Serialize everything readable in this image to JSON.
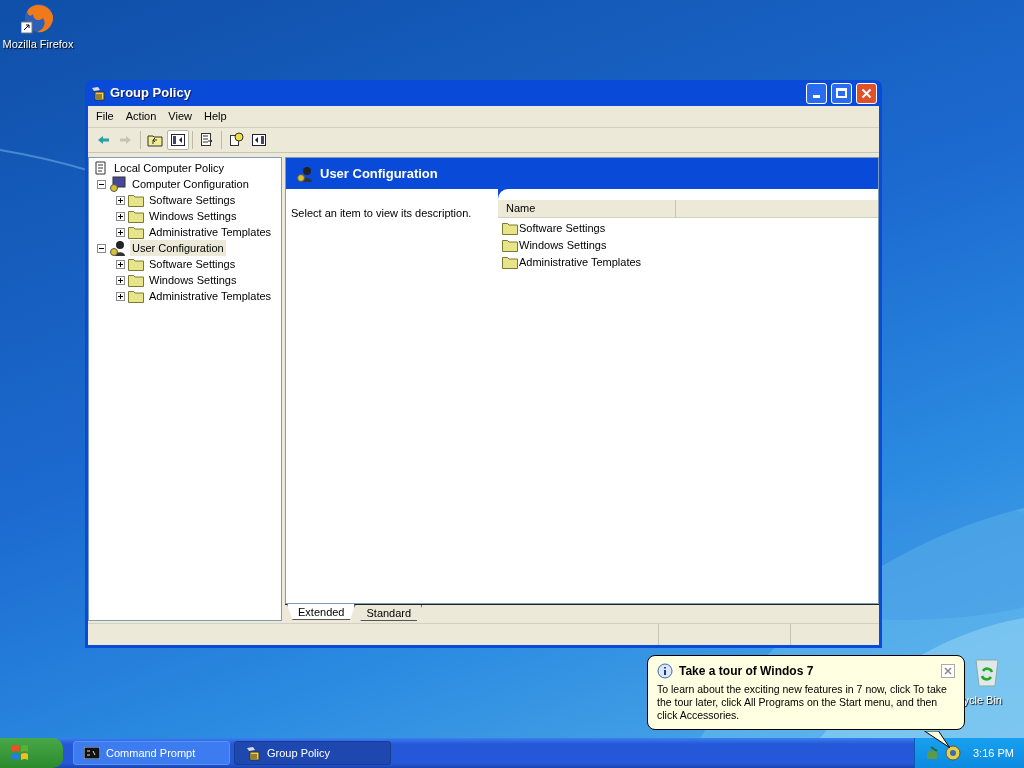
{
  "desktop_icons": [
    {
      "kind": "browser",
      "label": "Mozilla Firefox"
    },
    {
      "kind": "bin",
      "label": "ycle Bin"
    }
  ],
  "window": {
    "title": "Group Policy",
    "menu": [
      "File",
      "Action",
      "View",
      "Help"
    ],
    "toolbar": [
      {
        "kind": "back",
        "disabled": false,
        "pressed": false
      },
      {
        "kind": "forward",
        "disabled": true,
        "pressed": false
      },
      {
        "kind": "up",
        "disabled": false,
        "pressed": false
      },
      {
        "kind": "tree",
        "disabled": false,
        "pressed": true
      },
      {
        "kind": "export",
        "disabled": false,
        "pressed": false
      },
      {
        "kind": "help",
        "disabled": false,
        "pressed": false
      },
      {
        "kind": "pane",
        "disabled": false,
        "pressed": false
      }
    ],
    "tree": [
      {
        "label": "Local Computer Policy",
        "kind": "policy",
        "expanded": true,
        "selected": false,
        "children": [
          {
            "label": "Computer Configuration",
            "kind": "computer",
            "expanded": true,
            "selected": false,
            "children": [
              {
                "label": "Software Settings",
                "kind": "folder",
                "expanded": false,
                "selected": false
              },
              {
                "label": "Windows Settings",
                "kind": "folder",
                "expanded": false,
                "selected": false
              },
              {
                "label": "Administrative Templates",
                "kind": "folder",
                "expanded": false,
                "selected": false
              }
            ]
          },
          {
            "label": "User Configuration",
            "kind": "user",
            "expanded": true,
            "selected": true,
            "children": [
              {
                "label": "Software Settings",
                "kind": "folder",
                "expanded": false,
                "selected": false
              },
              {
                "label": "Windows Settings",
                "kind": "folder",
                "expanded": false,
                "selected": false
              },
              {
                "label": "Administrative Templates",
                "kind": "folder",
                "expanded": false,
                "selected": false
              }
            ]
          }
        ]
      }
    ],
    "details_title": "User Configuration",
    "description": "Select an item to view its description.",
    "list": {
      "columns": [
        "Name"
      ],
      "rows": [
        "Software Settings",
        "Windows Settings",
        "Administrative Templates"
      ]
    },
    "view_tabs": [
      {
        "label": "Extended",
        "selected": true
      },
      {
        "label": "Standard",
        "selected": false
      }
    ]
  },
  "balloon": {
    "title": "Take a tour of Windos 7",
    "text": "To learn about the exciting new features in 7 now, click To take the tour later, click All Programs on the Start menu, and then click Accessories."
  },
  "taskbar": {
    "buttons": [
      {
        "label": "Command Prompt",
        "kind": "console",
        "selected": false
      },
      {
        "label": "Group Policy",
        "kind": "policy",
        "selected": true
      }
    ],
    "clock": "3:16 PM"
  }
}
